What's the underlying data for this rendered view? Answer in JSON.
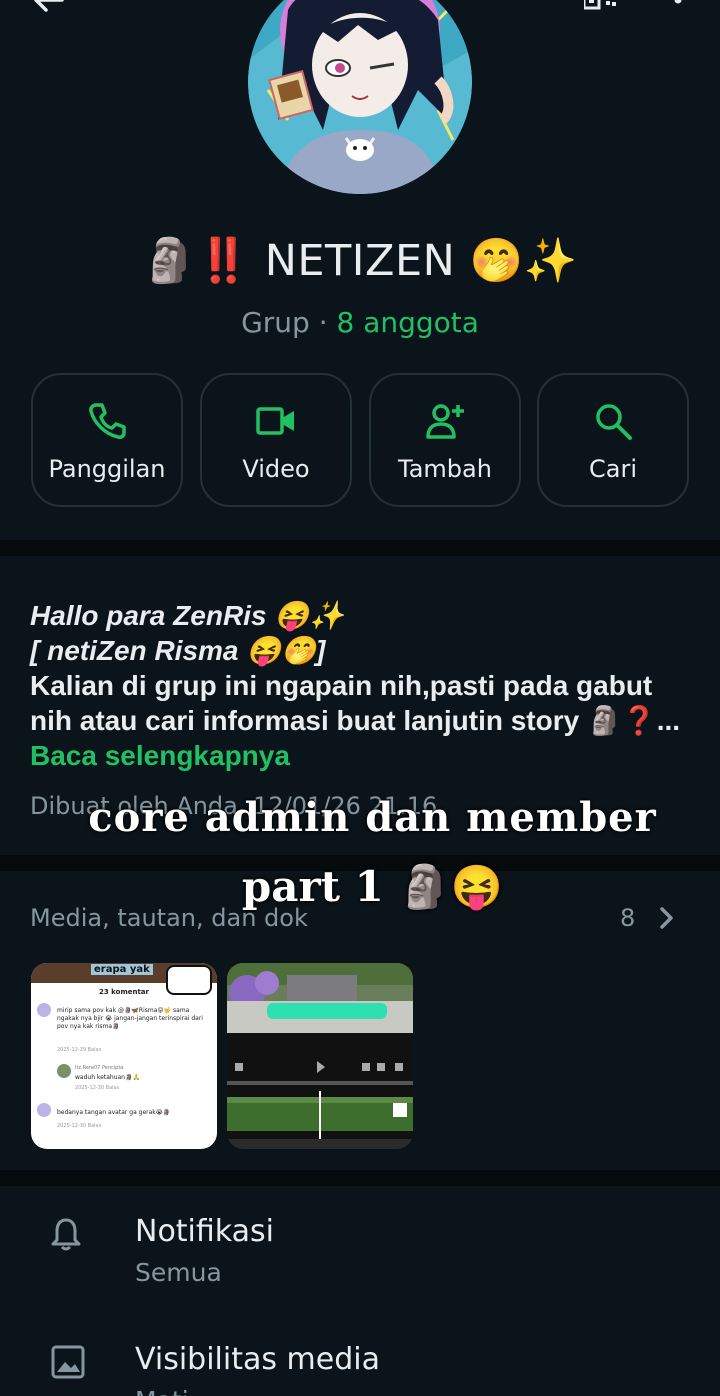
{
  "header": {
    "back_icon": "arrow-left-icon",
    "qr_icon": "qr-code-icon",
    "menu_icon": "more-vert-icon"
  },
  "group": {
    "name": "🗿‼️ NETIZEN 🤭✨",
    "type": "Grup",
    "separator": " · ",
    "members": "8 anggota"
  },
  "actions": [
    {
      "label": "Panggilan",
      "icon": "phone-icon"
    },
    {
      "label": "Video",
      "icon": "video-icon"
    },
    {
      "label": "Tambah",
      "icon": "add-person-icon"
    },
    {
      "label": "Cari",
      "icon": "search-icon"
    }
  ],
  "description": {
    "line1": "Hallo para ZenRis 😝✨",
    "line2": " [ netiZen Risma 😝🤭]",
    "line3": "Kalian di grup ini ngapain nih,pasti pada gabut nih atau cari informasi buat lanjutin story 🗿❓...",
    "read_more": "Baca selengkapnya",
    "created": "Dibuat oleh Anda, 12/01/26 21.16"
  },
  "overlay": {
    "line1": "core admin dan member",
    "line2": "part 1 🗿😝"
  },
  "media": {
    "label": "Media, tautan, dan dok",
    "count": "8",
    "thumb1": {
      "title": "erapa yak",
      "comments": "23 komentar",
      "c1_text": "mirip sama pov kak @🗿🦋Risma😝🤟 sama ngakak nya bjir 😭 jangan-jangan terinspirai dari pov nya kak risma🗿",
      "c1_meta": "2025-12-29   Balas",
      "c2_user": "Itz.Rere07   Pencipta",
      "c2_text": "waduh ketahuan🗿🙏",
      "c2_meta": "2025-12-30   Balas",
      "c3_text": "bedanya tangan avatar ga gerak😭🗿",
      "c3_meta": "2025-12-30   Balas"
    }
  },
  "settings": [
    {
      "title": "Notifikasi",
      "subtitle": "Semua",
      "icon": "bell-icon"
    },
    {
      "title": "Visibilitas media",
      "subtitle": "Mati",
      "icon": "image-icon"
    }
  ],
  "colors": {
    "background": "#0b141a",
    "accent": "#21c063",
    "secondary_text": "#8696a0",
    "card_border": "#233138"
  }
}
